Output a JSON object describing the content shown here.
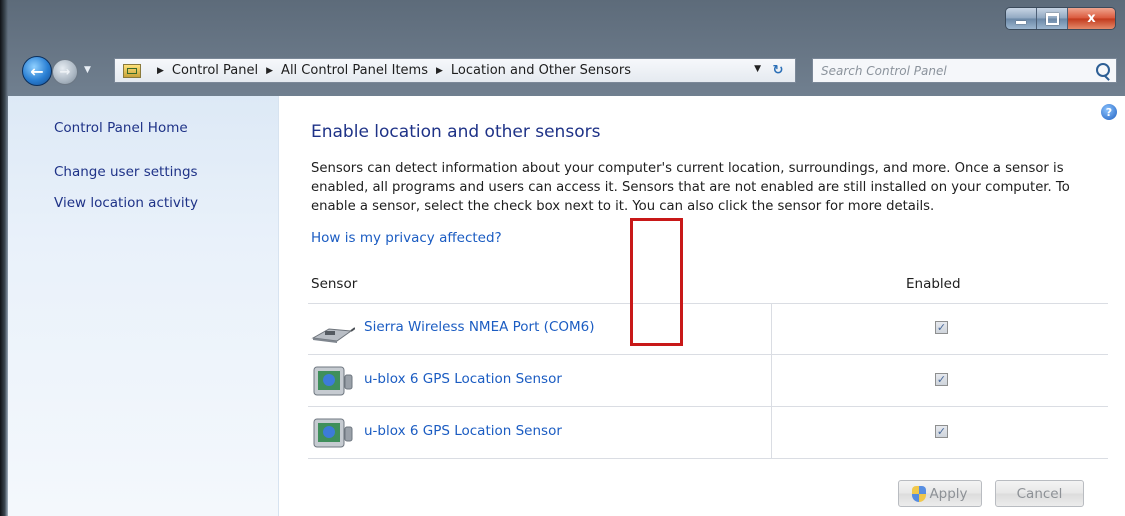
{
  "window": {
    "caption_minimize": "–",
    "caption_maximize": "□",
    "caption_close": "x"
  },
  "nav": {
    "back_glyph": "←",
    "forward_glyph": "→",
    "breadcrumbs": [
      "Control Panel",
      "All Control Panel Items",
      "Location and Other Sensors"
    ],
    "search_placeholder": "Search Control Panel"
  },
  "sidebar": {
    "items": [
      {
        "label": "Control Panel Home"
      },
      {
        "label": "Change user settings"
      },
      {
        "label": "View location activity"
      }
    ]
  },
  "main": {
    "title": "Enable location and other sensors",
    "description": "Sensors can detect information about your computer's current location, surroundings, and more. Once a sensor is enabled, all programs and users can access it. Sensors that are not enabled are still installed on your computer. To enable a sensor, select the check box next to it. You can also click the sensor for more details.",
    "privacy_link": "How is my privacy affected?",
    "help_glyph": "?",
    "columns": {
      "sensor": "Sensor",
      "enabled": "Enabled"
    },
    "sensors": [
      {
        "name": "Sierra Wireless NMEA Port (COM6)",
        "icon": "serial-port-icon",
        "enabled": true
      },
      {
        "name": "u-blox 6 GPS Location Sensor",
        "icon": "gps-sensor-icon",
        "enabled": true
      },
      {
        "name": "u-blox 6 GPS Location Sensor",
        "icon": "gps-sensor-icon",
        "enabled": true
      }
    ],
    "apply_label": "Apply",
    "cancel_label": "Cancel",
    "check_glyph": "✓"
  },
  "colors": {
    "link": "#1b5cc2",
    "title": "#1e3287",
    "highlight": "#c81818"
  }
}
